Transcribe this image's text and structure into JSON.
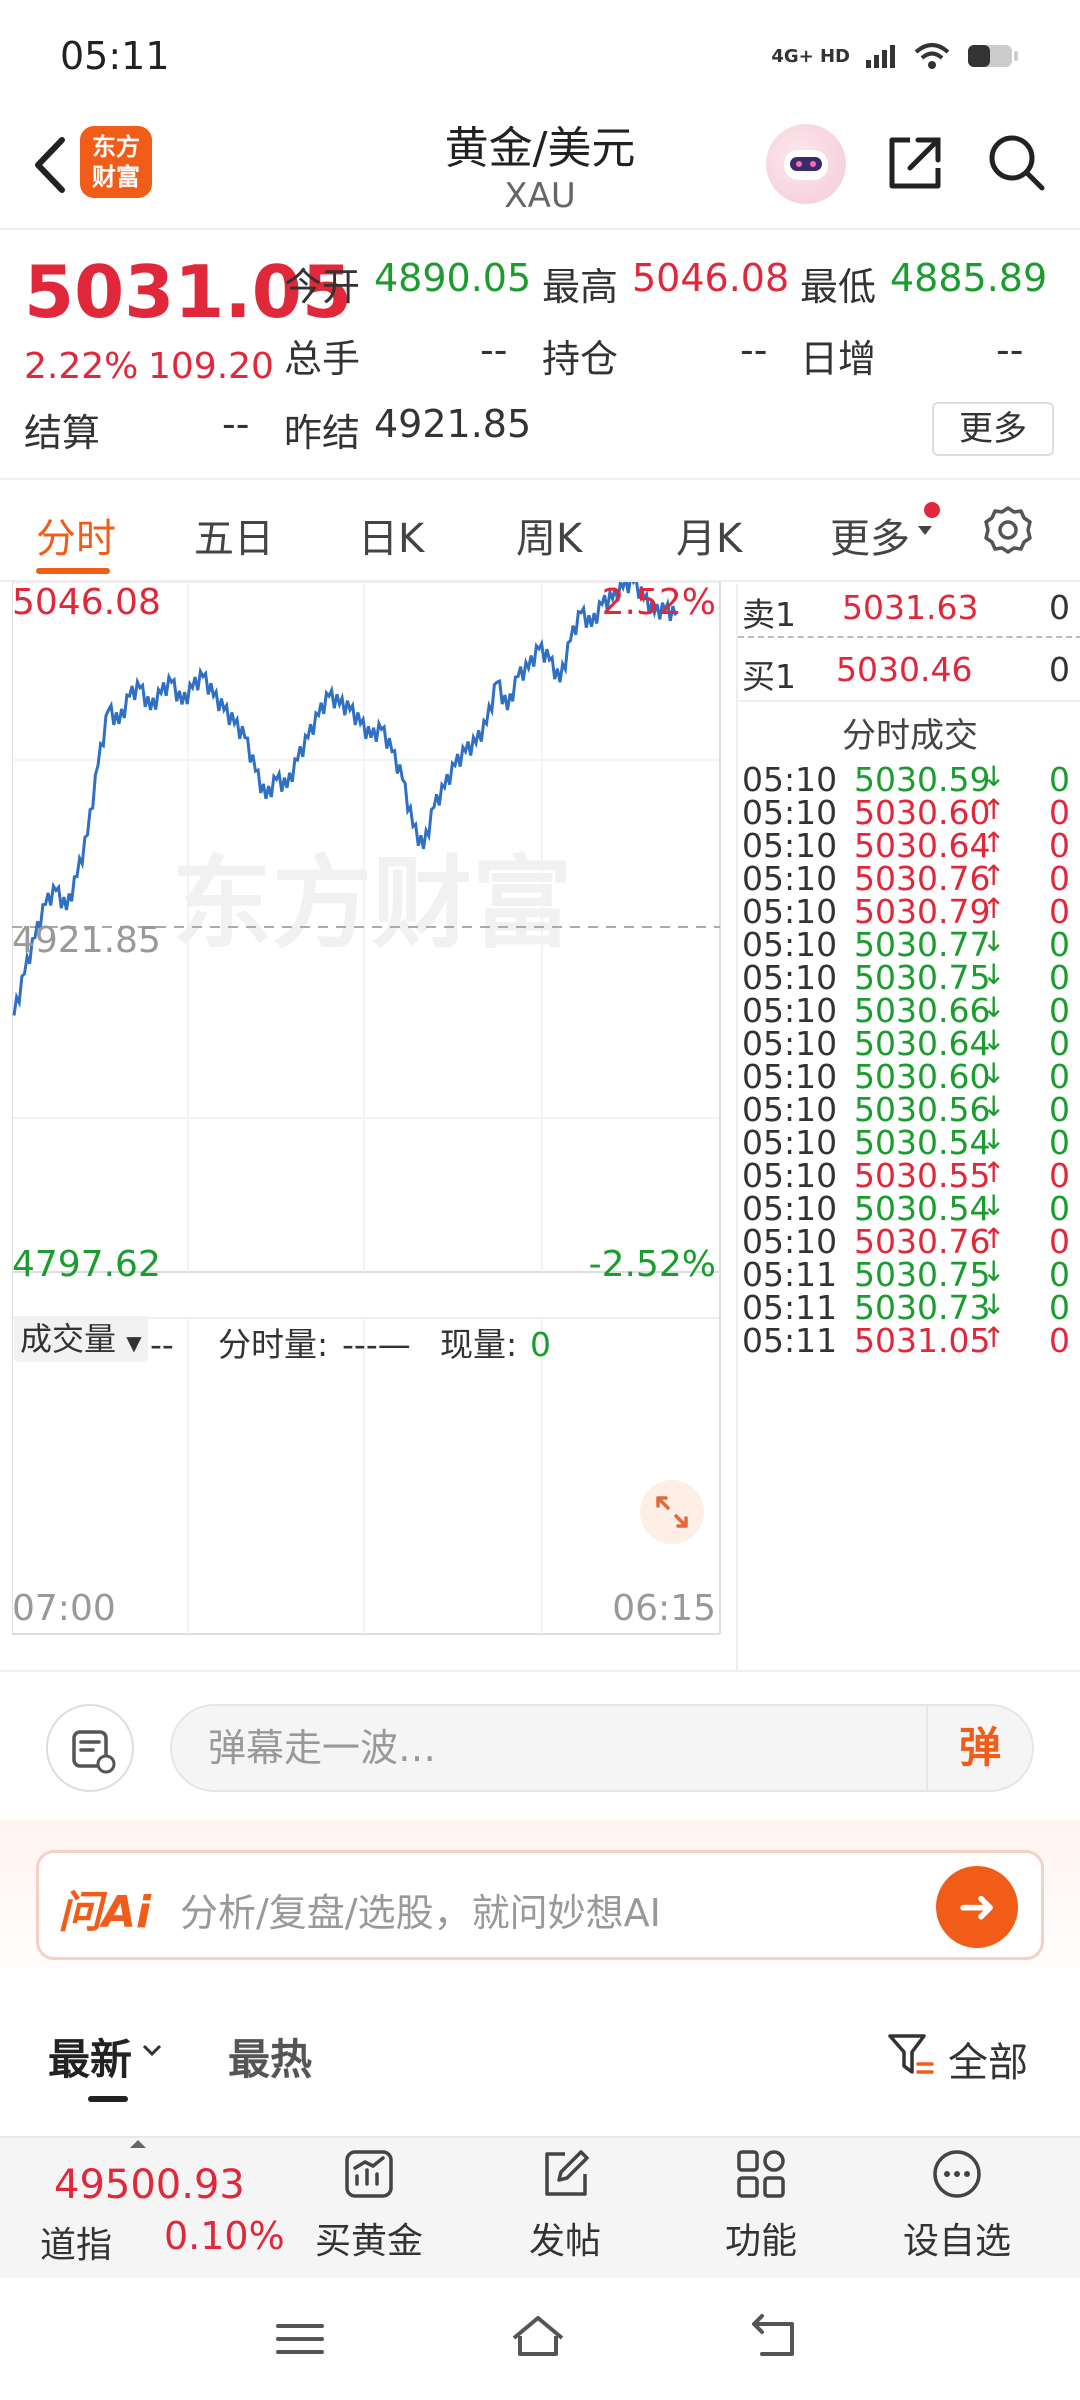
{
  "status_bar": {
    "time": "05:11",
    "network": "4G+ HD"
  },
  "header": {
    "title": "黄金/美元",
    "subtitle": "XAU",
    "brand_line1": "东方",
    "brand_line2": "财富"
  },
  "quote": {
    "price": "5031.05",
    "change_pct": "2.22%",
    "change": "109.20",
    "open_label": "今开",
    "open": "4890.05",
    "high_label": "最高",
    "high": "5046.08",
    "low_label": "最低",
    "low": "4885.89",
    "volume_label": "总手",
    "volume": "--",
    "position_label": "持仓",
    "position": "--",
    "daily_inc_label": "日增",
    "daily_inc": "--",
    "settle_label": "结算",
    "settle": "--",
    "prev_settle_label": "昨结",
    "prev_settle": "4921.85",
    "more_label": "更多"
  },
  "tabs": [
    "分时",
    "五日",
    "日K",
    "周K",
    "月K",
    "更多"
  ],
  "chart": {
    "watermark": "东方财富",
    "top_value": "5046.08",
    "top_pct": "2.52%",
    "mid_value": "4921.85",
    "bottom_value": "4797.62",
    "bottom_pct": "-2.52%",
    "start_time": "07:00",
    "end_time": "06:15",
    "volume_selector": "成交量",
    "volume_value": "--",
    "minute_vol_label": "分时量:",
    "minute_vol_value": "---—",
    "current_vol_label": "现量:",
    "current_vol_value": "0"
  },
  "chart_data": {
    "type": "line",
    "title": "",
    "xlabel": "",
    "ylabel": "",
    "x_range": [
      "07:00",
      "06:15"
    ],
    "ylim": [
      4797.62,
      5046.08
    ],
    "reference_line": 4921.85,
    "series": [
      {
        "values": [
          4890,
          4905,
          4918,
          4930,
          4935,
          4928,
          4940,
          4955,
          4980,
          5000,
          4995,
          5005,
          5008,
          5000,
          5006,
          5010,
          5002,
          5008,
          5012,
          5005,
          5000,
          4995,
          4990,
          4978,
          4968,
          4975,
          4972,
          4982,
          4990,
          4998,
          5005,
          5002,
          5000,
          4995,
          4990,
          4993,
          4985,
          4975,
          4958,
          4950,
          4965,
          4972,
          4980,
          4985,
          4988,
          4995,
          5010,
          5000,
          5012,
          5015,
          5022,
          5018,
          5010,
          5025,
          5035,
          5030,
          5038,
          5040,
          5044,
          5046,
          5040,
          5035,
          5036,
          5034
        ]
      }
    ]
  },
  "order_book": {
    "sell_label": "卖1",
    "sell_price": "5031.63",
    "sell_vol": "0",
    "buy_label": "买1",
    "buy_price": "5030.46",
    "buy_vol": "0",
    "trades_title": "分时成交"
  },
  "trades": [
    {
      "time": "05:10",
      "price": "5030.59",
      "dir": "down",
      "vol": "0"
    },
    {
      "time": "05:10",
      "price": "5030.60",
      "dir": "up",
      "vol": "0"
    },
    {
      "time": "05:10",
      "price": "5030.64",
      "dir": "up",
      "vol": "0"
    },
    {
      "time": "05:10",
      "price": "5030.76",
      "dir": "up",
      "vol": "0"
    },
    {
      "time": "05:10",
      "price": "5030.79",
      "dir": "up",
      "vol": "0"
    },
    {
      "time": "05:10",
      "price": "5030.77",
      "dir": "down",
      "vol": "0"
    },
    {
      "time": "05:10",
      "price": "5030.75",
      "dir": "down",
      "vol": "0"
    },
    {
      "time": "05:10",
      "price": "5030.66",
      "dir": "down",
      "vol": "0"
    },
    {
      "time": "05:10",
      "price": "5030.64",
      "dir": "down",
      "vol": "0"
    },
    {
      "time": "05:10",
      "price": "5030.60",
      "dir": "down",
      "vol": "0"
    },
    {
      "time": "05:10",
      "price": "5030.56",
      "dir": "down",
      "vol": "0"
    },
    {
      "time": "05:10",
      "price": "5030.54",
      "dir": "down",
      "vol": "0"
    },
    {
      "time": "05:10",
      "price": "5030.55",
      "dir": "up",
      "vol": "0"
    },
    {
      "time": "05:10",
      "price": "5030.54",
      "dir": "down",
      "vol": "0"
    },
    {
      "time": "05:10",
      "price": "5030.76",
      "dir": "up",
      "vol": "0"
    },
    {
      "time": "05:11",
      "price": "5030.75",
      "dir": "down",
      "vol": "0"
    },
    {
      "time": "05:11",
      "price": "5030.73",
      "dir": "down",
      "vol": "0"
    },
    {
      "time": "05:11",
      "price": "5031.05",
      "dir": "up",
      "vol": "0"
    }
  ],
  "danmaku": {
    "placeholder": "弹幕走一波…",
    "send_label": "弹"
  },
  "ai": {
    "logo": "问Ai",
    "placeholder": "分析/复盘/选股，就问妙想AI"
  },
  "feed": {
    "latest": "最新",
    "hot": "最热",
    "filter": "全部"
  },
  "toolbar": {
    "index_value": "49500.93",
    "index_name": "道指",
    "index_pct": "0.10%",
    "buy_gold": "买黄金",
    "post": "发帖",
    "functions": "功能",
    "add_watch": "设自选"
  },
  "colors": {
    "accent": "#f25c19",
    "up": "#e0283a",
    "down": "#1a9c2e",
    "line": "#2f6fc4"
  }
}
